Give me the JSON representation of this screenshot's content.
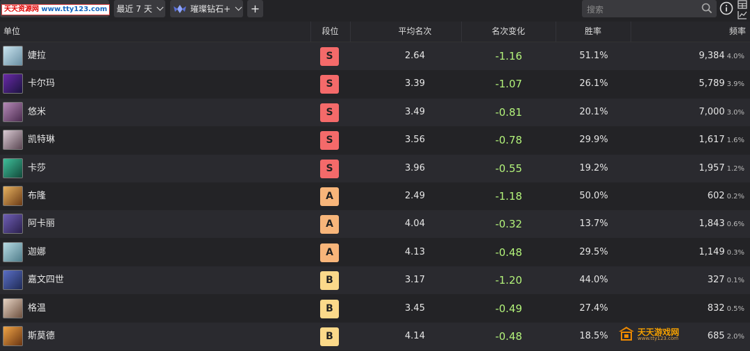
{
  "watermark_top": {
    "part1": "天天资源网",
    "part2": " www.tty123.com"
  },
  "toolbar": {
    "period_label": "最近 7 天",
    "rank_label": "璀璨钻石+",
    "add_label": "+",
    "search_placeholder": "搜索"
  },
  "columns": {
    "unit": "单位",
    "tier": "段位",
    "avg": "平均名次",
    "change": "名次变化",
    "win": "胜率",
    "freq": "频率"
  },
  "tier_colors": {
    "S": "#f46a6a",
    "A": "#f7b57a",
    "B": "#fbd98a"
  },
  "rows": [
    {
      "name": "婕拉",
      "tier": "S",
      "avg": "2.64",
      "change": "-1.16",
      "win": "51.1%",
      "freq": "9,384",
      "pct": "4.0%",
      "avatar_colors": [
        "#c9e4ef",
        "#6a8fa3"
      ]
    },
    {
      "name": "卡尔玛",
      "tier": "S",
      "avg": "3.39",
      "change": "-1.07",
      "win": "26.1%",
      "freq": "5,789",
      "pct": "3.9%",
      "avatar_colors": [
        "#6a2aa8",
        "#1b1340"
      ]
    },
    {
      "name": "悠米",
      "tier": "S",
      "avg": "3.49",
      "change": "-0.81",
      "win": "20.1%",
      "freq": "7,000",
      "pct": "3.0%",
      "avatar_colors": [
        "#b58ab8",
        "#4a2b4e"
      ]
    },
    {
      "name": "凯特琳",
      "tier": "S",
      "avg": "3.56",
      "change": "-0.78",
      "win": "29.9%",
      "freq": "1,617",
      "pct": "1.6%",
      "avatar_colors": [
        "#d9cad3",
        "#5a4652"
      ]
    },
    {
      "name": "卡莎",
      "tier": "S",
      "avg": "3.96",
      "change": "-0.55",
      "win": "19.2%",
      "freq": "1,957",
      "pct": "1.2%",
      "avatar_colors": [
        "#3fbf9a",
        "#124a3a"
      ]
    },
    {
      "name": "布隆",
      "tier": "A",
      "avg": "2.49",
      "change": "-1.18",
      "win": "50.0%",
      "freq": "602",
      "pct": "0.2%",
      "avatar_colors": [
        "#e7b260",
        "#6b3b16"
      ]
    },
    {
      "name": "阿卡丽",
      "tier": "A",
      "avg": "4.04",
      "change": "-0.32",
      "win": "13.7%",
      "freq": "1,843",
      "pct": "0.6%",
      "avatar_colors": [
        "#6f5fb6",
        "#2a1f4c"
      ]
    },
    {
      "name": "迦娜",
      "tier": "A",
      "avg": "4.13",
      "change": "-0.48",
      "win": "29.5%",
      "freq": "1,149",
      "pct": "0.3%",
      "avatar_colors": [
        "#b7dbe3",
        "#4f7c8a"
      ]
    },
    {
      "name": "嘉文四世",
      "tier": "B",
      "avg": "3.17",
      "change": "-1.20",
      "win": "44.0%",
      "freq": "327",
      "pct": "0.1%",
      "avatar_colors": [
        "#5a6fc6",
        "#1f2a55"
      ]
    },
    {
      "name": "格温",
      "tier": "B",
      "avg": "3.45",
      "change": "-0.49",
      "win": "27.4%",
      "freq": "832",
      "pct": "0.5%",
      "avatar_colors": [
        "#e6d3c3",
        "#6e5140"
      ]
    },
    {
      "name": "斯莫德",
      "tier": "B",
      "avg": "4.14",
      "change": "-0.48",
      "win": "18.5%",
      "freq": "685",
      "pct": "2.0%",
      "avatar_colors": [
        "#f0a446",
        "#6a3512"
      ]
    }
  ],
  "watermark_bottom": {
    "title": "天天游戏网",
    "url": "www.tty123.com"
  }
}
